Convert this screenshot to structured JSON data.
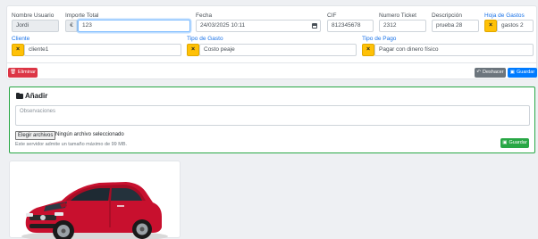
{
  "gastos_form": {
    "nombre_usuario": {
      "label": "Nombre Usuario",
      "value": "Jordi"
    },
    "importe_total": {
      "label": "Importe Total",
      "currency": "€",
      "value": "123"
    },
    "fecha": {
      "label": "Fecha",
      "value": "24/03/2025 10:11"
    },
    "cif": {
      "label": "CIF",
      "value": "812345678"
    },
    "numero_ticket": {
      "label": "Numero Ticket",
      "value": "2312"
    },
    "descripcion": {
      "label": "Descripción",
      "value": "prueba 28"
    },
    "hoja_gastos": {
      "label": "Hoja de Gastos",
      "value": "gastos 2"
    },
    "cliente": {
      "label": "Cliente",
      "value": "cliente1"
    },
    "tipo_gasto": {
      "label": "Tipo de Gasto",
      "value": "Costo peaje"
    },
    "tipo_pago": {
      "label": "Tipo de Pago",
      "value": "Pagar con dinero físico"
    },
    "clear_glyph": "×",
    "actions": {
      "eliminar": "Eliminar",
      "deshacer": "Deshacer",
      "guardar": "Guardar"
    }
  },
  "anadir": {
    "title": "Añadir",
    "observaciones_placeholder": "Observaciones",
    "file_button": "Elegir archivos",
    "file_status": "Ningún archivo seleccionado",
    "size_note": "Este servidor admite un tamaño máximo de 99 MB.",
    "guardar": "Guardar"
  },
  "colors": {
    "accent": "#007bff",
    "danger": "#dc3545",
    "success": "#28a745",
    "warning": "#ffc107",
    "secondary": "#6c757d"
  }
}
